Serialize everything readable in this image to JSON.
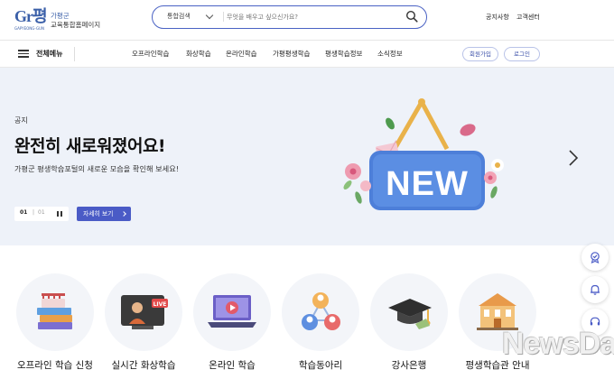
{
  "header": {
    "logo_mark": "Gr평",
    "logo_sub": "GAPYEONG-GUN",
    "logo_line1": "가평군",
    "logo_line2": "교육통합홈페이지",
    "search_category": "통합검색",
    "search_placeholder": "무엇을 배우고 싶으신가요?",
    "util_links": [
      "공지사항",
      "고객센터"
    ]
  },
  "nav": {
    "menu_label": "전체메뉴",
    "items": [
      "오프라인학습",
      "화상학습",
      "온라인학습",
      "가평평생학습",
      "평생학습정보",
      "소식정보"
    ],
    "join_label": "회원가입",
    "login_label": "로그인"
  },
  "hero": {
    "eyebrow": "공지",
    "headline": "완전히 새로워졌어요!",
    "subline": "가평군 평생학습포털의 새로운 모습을 확인해 보세요!",
    "pager_current": "01",
    "pager_sep": "|",
    "pager_total": "01",
    "detail_label": "자세히 보기",
    "sign_text": "NEW"
  },
  "categories": [
    {
      "label": "오프라인 학습 신청",
      "icon": "books-icon"
    },
    {
      "label": "실시간 화상학습",
      "icon": "live-video-icon"
    },
    {
      "label": "온라인 학습",
      "icon": "laptop-play-icon"
    },
    {
      "label": "학습동아리",
      "icon": "people-network-icon"
    },
    {
      "label": "강사은행",
      "icon": "graduation-cap-icon"
    },
    {
      "label": "평생학습관 안내",
      "icon": "building-icon"
    }
  ],
  "floating": [
    "certificate-icon",
    "bell-icon",
    "headset-icon"
  ],
  "watermark": "NewsDa",
  "colors": {
    "accent": "#4a5bc6",
    "hero_bg": "#eef2f9",
    "sign_blue": "#4d7fd9",
    "search_border": "#4a62c4"
  }
}
